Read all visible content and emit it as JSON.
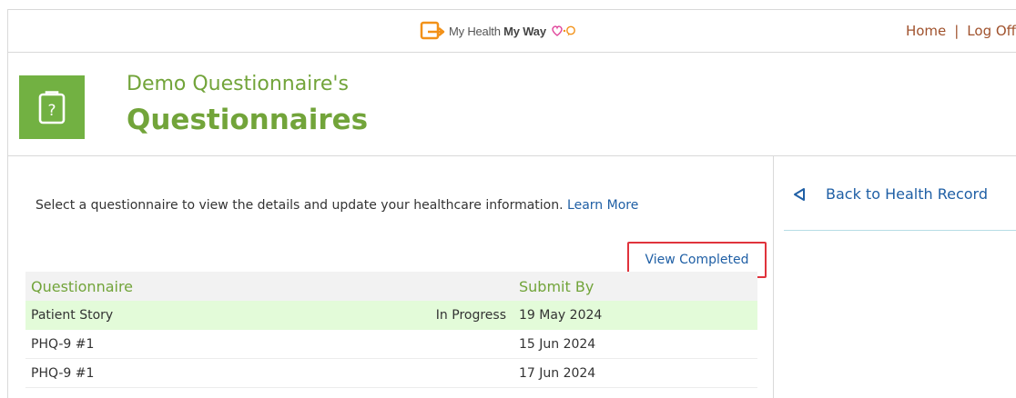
{
  "topbar": {
    "logo_text_regular": "My Health ",
    "logo_text_bold": "My Way",
    "nav": {
      "home": "Home",
      "separator": "|",
      "logoff": "Log Off"
    }
  },
  "header": {
    "icon": "clipboard-question-icon",
    "subtitle": "Demo Questionnaire's",
    "title": "Questionnaires"
  },
  "main": {
    "intro_text": "Select a questionnaire to view the details and update your healthcare information. ",
    "learn_more": "Learn More",
    "view_completed": "View Completed",
    "table": {
      "headers": {
        "questionnaire": "Questionnaire",
        "status": "",
        "submit_by": "Submit By"
      },
      "rows": [
        {
          "name": "Patient Story",
          "status": "In Progress",
          "date": "19 May 2024"
        },
        {
          "name": "PHQ-9 #1",
          "status": "",
          "date": "15 Jun 2024"
        },
        {
          "name": "PHQ-9 #1",
          "status": "",
          "date": "17 Jun 2024"
        }
      ]
    }
  },
  "sidebar": {
    "back_link": "Back to Health Record",
    "back_icon": "triangle-left-outline-icon"
  },
  "colors": {
    "brand_green": "#72a43a",
    "icon_green": "#72b142",
    "link_blue": "#1f5fa5",
    "nav_brown": "#a0522d",
    "highlight_red": "#e0333c",
    "active_row": "#e3fbd9"
  }
}
